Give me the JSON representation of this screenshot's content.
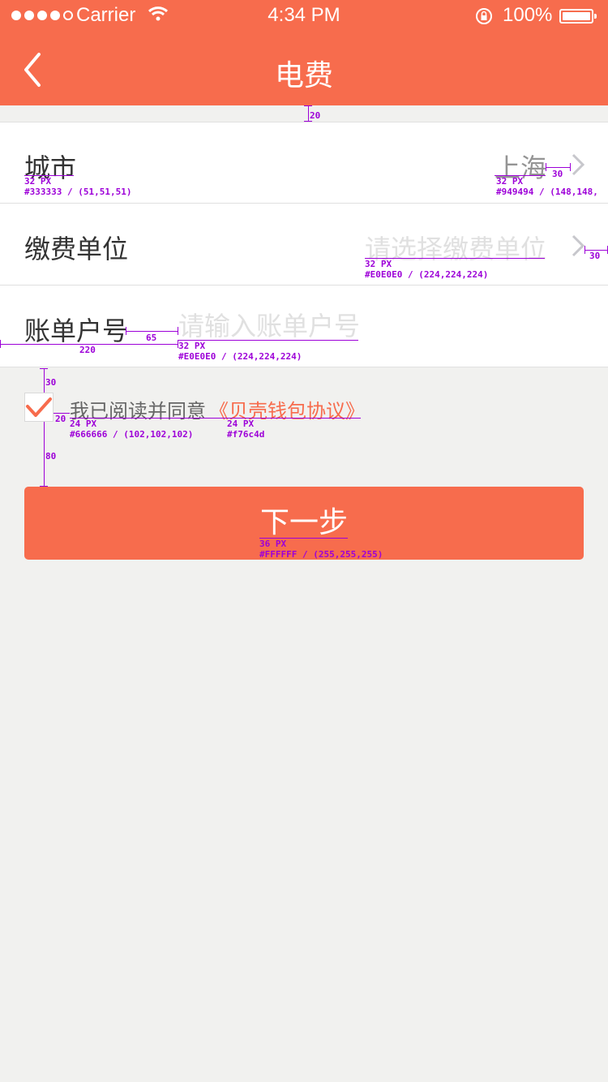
{
  "status_bar": {
    "carrier": "Carrier",
    "time": "4:34 PM",
    "battery": "100%",
    "signal_icon": "signal-dots-icon",
    "wifi_icon": "wifi-icon",
    "lock_icon": "rotation-lock-icon",
    "battery_icon": "battery-icon"
  },
  "header": {
    "title": "电费",
    "back_icon": "chevron-left-icon"
  },
  "form": {
    "city_label": "城市",
    "city_value": "上海",
    "unit_label": "缴费单位",
    "unit_placeholder": "请选择缴费单位",
    "account_label": "账单户号",
    "account_placeholder": "请输入账单户号"
  },
  "agreement": {
    "checked": true,
    "text": "我已阅读并同意",
    "link": "《贝壳钱包协议》"
  },
  "next_button": {
    "label": "下一步"
  },
  "annotations": {
    "gap_top": "20",
    "city_spec": "32 PX",
    "city_color": "#333333 / (51,51,51)",
    "city_value_spec": "32 PX",
    "city_value_color": "#949494 / (148,148,",
    "chev_gap_1": "30",
    "chev_gap_2": "30",
    "unit_spec": "32 PX",
    "unit_color": "#E0E0E0 / (224,224,224)",
    "gap_65": "65",
    "gap_220": "220",
    "account_spec": "32 PX",
    "account_color": "#E0E0E0 / (224,224,224)",
    "gap_30": "30",
    "gap_20": "20",
    "gap_80": "80",
    "agree_spec": "24 PX",
    "agree_color": "#666666 / (102,102,102)",
    "link_spec": "24 PX",
    "link_color": "#f76c4d",
    "button_spec": "36 PX",
    "button_color": "#FFFFFF / (255,255,255)"
  },
  "colors": {
    "accent": "#f76c4d",
    "label_text": "#333333",
    "value_text": "#949494",
    "placeholder_text": "#e0e0e0",
    "agree_text": "#666666",
    "background": "#f1f1ef",
    "annotation": "#9d00d8"
  }
}
